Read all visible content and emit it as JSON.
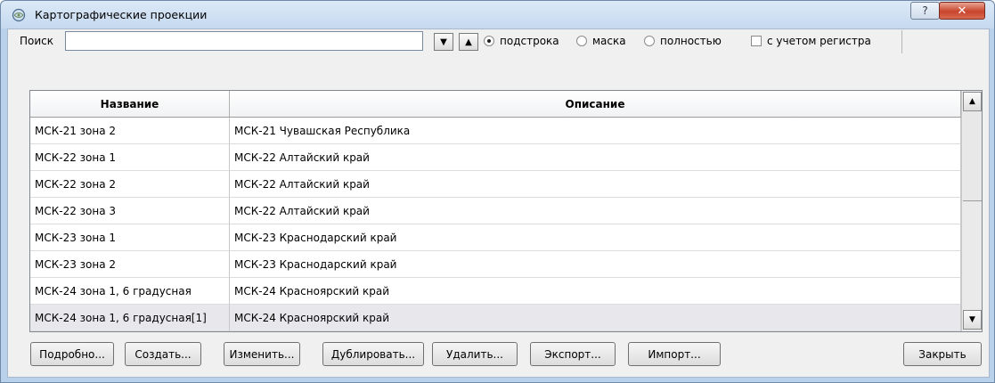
{
  "window": {
    "title": "Картографические проекции",
    "help_label": "?",
    "close_label": "✕"
  },
  "search": {
    "label": "Поиск",
    "value": "",
    "down_label": "▼",
    "up_label": "▲",
    "mode_substring": "подстрока",
    "mode_mask": "маска",
    "mode_full": "полностью",
    "case_sensitive": "с учетом регистра",
    "selected_mode": "подстрока",
    "case_checked": false
  },
  "table": {
    "columns": [
      "Название",
      "Описание"
    ],
    "rows": [
      [
        "МСК-21 зона 2",
        "МСК-21 Чувашская Республика"
      ],
      [
        "МСК-22 зона 1",
        "МСК-22 Алтайский край"
      ],
      [
        "МСК-22 зона 2",
        "МСК-22 Алтайский край"
      ],
      [
        "МСК-22 зона 3",
        "МСК-22 Алтайский край"
      ],
      [
        "МСК-23 зона 1",
        "МСК-23 Краснодарский край"
      ],
      [
        "МСК-23 зона 2",
        "МСК-23 Краснодарский край"
      ],
      [
        "МСК-24 зона 1, 6 градусная",
        "МСК-24 Красноярский край"
      ],
      [
        "МСК-24 зона 1, 6 градусная[1]",
        "МСК-24 Красноярский край"
      ]
    ],
    "selected_row_index": 7,
    "scroll_up": "▲",
    "scroll_down": "▼"
  },
  "buttons": {
    "details": "Подробно...",
    "create": "Создать...",
    "edit": "Изменить...",
    "duplicate": "Дублировать...",
    "delete": "Удалить...",
    "export": "Экспорт...",
    "import": "Импорт...",
    "close": "Закрыть"
  },
  "colors": {
    "title_bar": "#c5d9ef",
    "close_button": "#c8452c",
    "selected_row": "#e8e8ec"
  }
}
